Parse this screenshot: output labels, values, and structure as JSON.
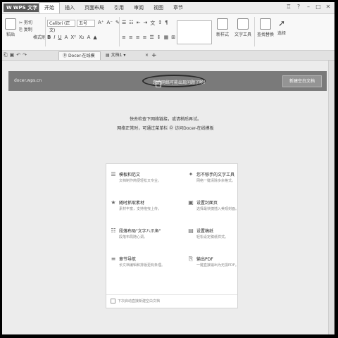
{
  "app": {
    "logo_text": "WPS 文字",
    "logo_glyph": "W"
  },
  "menu": [
    {
      "label": "开始",
      "active": true
    },
    {
      "label": "插入"
    },
    {
      "label": "页面布局"
    },
    {
      "label": "引用"
    },
    {
      "label": "审阅"
    },
    {
      "label": "视图"
    },
    {
      "label": "章节"
    }
  ],
  "ribbon": {
    "paste_label": "粘贴",
    "cut_label": "剪切",
    "copy_label": "复制",
    "format_painter_label": "格式刷",
    "font_name": "Calibri (正文)",
    "font_size": "五号",
    "new_style_label": "新样式",
    "text_tools_label": "文字工具",
    "find_replace_label": "查找替换",
    "select_label": "选择"
  },
  "tabs": [
    {
      "label": "Docer-在线模板",
      "active": true
    },
    {
      "label": "文档1"
    }
  ],
  "banner": {
    "url": "docer.wps.cn",
    "network_message": "您的网络可能出现问题了哟！",
    "new_blank_button": "新建空白文档"
  },
  "message": {
    "line1": "快去检查下网络链接，或请稍后再试。",
    "line2": "网络正常时，可通过菜单栏",
    "line2_link": "访问Docer-在线模板"
  },
  "features": [
    {
      "icon": "document-icon",
      "glyph": "☰",
      "title": "模板和范文",
      "desc": "文档制作简便轻松又专业。"
    },
    {
      "icon": "text-tool-icon",
      "glyph": "✦",
      "title": "您不够手的文字工具",
      "desc": "网络一键清除多余格式。"
    },
    {
      "icon": "star-icon",
      "glyph": "★",
      "title": "随时抓取素材",
      "desc": "素材丰富，支持拖曳上传。"
    },
    {
      "icon": "cover-icon",
      "glyph": "▣",
      "title": "设置封面页",
      "desc": "选择最快捷插入美观封面。"
    },
    {
      "icon": "layout-icon",
      "glyph": "☷",
      "title": "段落布局\"文字八爪鱼\"",
      "desc": "段落布局随心调。"
    },
    {
      "icon": "paper-icon",
      "glyph": "▤",
      "title": "设置稿纸",
      "desc": "轻松设定稿纸样式。"
    },
    {
      "icon": "chapter-icon",
      "glyph": "≡",
      "title": "章节导航",
      "desc": "长文档编辑和排版更有条理。"
    },
    {
      "icon": "pdf-icon",
      "glyph": "⎘",
      "title": "输出PDF",
      "desc": "一键直接输出为无损PDF。"
    }
  ],
  "footer_checkbox": "下次启动直接新建空白文档"
}
